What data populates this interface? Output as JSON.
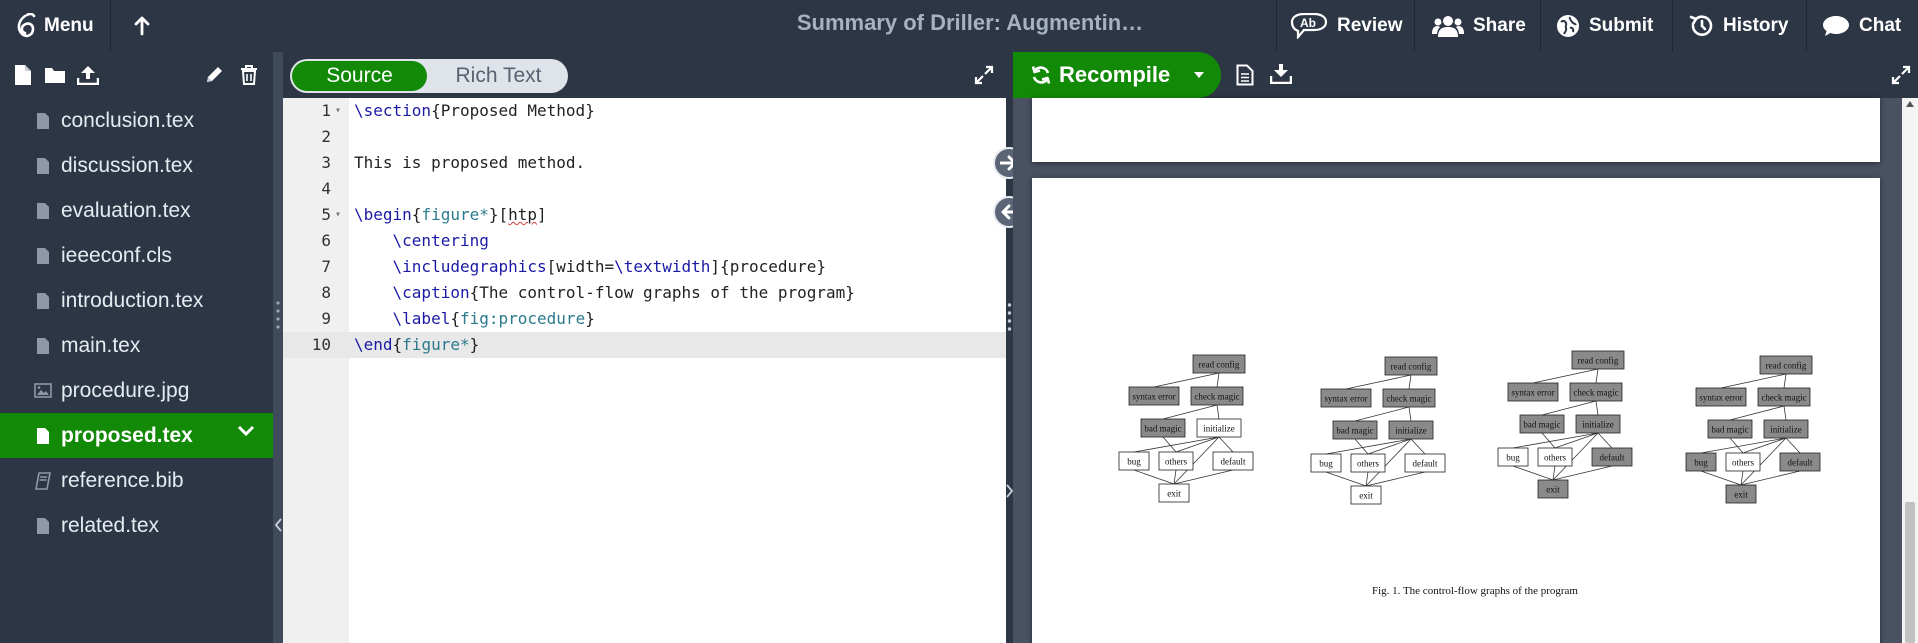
{
  "topbar": {
    "menu_label": "Menu",
    "project_title": "Summary of Driller: Augmentin…",
    "buttons": [
      {
        "label": "Review",
        "icon": "review-icon"
      },
      {
        "label": "Share",
        "icon": "users-icon"
      },
      {
        "label": "Submit",
        "icon": "globe-icon"
      },
      {
        "label": "History",
        "icon": "history-icon"
      },
      {
        "label": "Chat",
        "icon": "chat-bubble-icon"
      }
    ]
  },
  "file_tree": {
    "toolbar_icons": [
      "new-file-icon",
      "new-folder-icon",
      "upload-icon",
      "rename-pencil-icon",
      "delete-trash-icon"
    ],
    "files": [
      {
        "name": "conclusion.tex",
        "type": "file"
      },
      {
        "name": "discussion.tex",
        "type": "file"
      },
      {
        "name": "evaluation.tex",
        "type": "file"
      },
      {
        "name": "ieeeconf.cls",
        "type": "file"
      },
      {
        "name": "introduction.tex",
        "type": "file"
      },
      {
        "name": "main.tex",
        "type": "file"
      },
      {
        "name": "procedure.jpg",
        "type": "image"
      },
      {
        "name": "proposed.tex",
        "type": "file",
        "active": true
      },
      {
        "name": "reference.bib",
        "type": "bib"
      },
      {
        "name": "related.tex",
        "type": "file"
      }
    ]
  },
  "editor": {
    "mode_source": "Source",
    "mode_rich": "Rich Text",
    "active_mode": "Source",
    "current_line": 10,
    "lines": [
      {
        "n": "1",
        "fold": true,
        "segs": [
          [
            "kw",
            "\\section"
          ],
          [
            "",
            "{Proposed Method}"
          ]
        ]
      },
      {
        "n": "2",
        "segs": []
      },
      {
        "n": "3",
        "segs": [
          [
            "",
            "This is proposed method."
          ]
        ]
      },
      {
        "n": "4",
        "segs": []
      },
      {
        "n": "5",
        "fold": true,
        "segs": [
          [
            "kw",
            "\\begin"
          ],
          [
            "",
            "{"
          ],
          [
            "arg",
            "figure*"
          ],
          [
            "",
            "}["
          ],
          [
            "squig",
            "htp"
          ],
          [
            "",
            "]"
          ]
        ]
      },
      {
        "n": "6",
        "segs": [
          [
            "",
            "    "
          ],
          [
            "kw",
            "\\centering"
          ]
        ]
      },
      {
        "n": "7",
        "segs": [
          [
            "",
            "    "
          ],
          [
            "kw",
            "\\includegraphics"
          ],
          [
            "",
            "[width="
          ],
          [
            "kw",
            "\\textwidth"
          ],
          [
            "",
            "]{procedure}"
          ]
        ]
      },
      {
        "n": "8",
        "segs": [
          [
            "",
            "    "
          ],
          [
            "kw",
            "\\caption"
          ],
          [
            "",
            "{The control-flow graphs of the program}"
          ]
        ]
      },
      {
        "n": "9",
        "segs": [
          [
            "",
            "    "
          ],
          [
            "kw",
            "\\label"
          ],
          [
            "",
            "{"
          ],
          [
            "arg",
            "fig:procedure"
          ],
          [
            "",
            "}"
          ]
        ]
      },
      {
        "n": "10",
        "segs": [
          [
            "kw",
            "\\end"
          ],
          [
            "",
            "{"
          ],
          [
            "arg",
            "figure*"
          ],
          [
            "",
            "}"
          ]
        ]
      }
    ]
  },
  "pdf": {
    "recompile_label": "Recompile",
    "figure_caption": "Fig. 1.   The control-flow graphs of the program",
    "graph_labels": {
      "read_config": "read config",
      "syntax_error": "syntax error",
      "check_magic": "check magic",
      "bad_magic": "bad magic",
      "initialize": "initialize",
      "bug": "bug",
      "others": "others",
      "default": "default",
      "exit": "exit"
    },
    "graphs": [
      {
        "filled": [
          "read_config",
          "syntax_error",
          "check_magic",
          "bad_magic"
        ]
      },
      {
        "filled": [
          "read_config",
          "syntax_error",
          "check_magic",
          "bad_magic",
          "initialize"
        ]
      },
      {
        "filled": [
          "read_config",
          "syntax_error",
          "check_magic",
          "bad_magic",
          "initialize",
          "default",
          "exit"
        ]
      },
      {
        "filled": [
          "read_config",
          "syntax_error",
          "check_magic",
          "bad_magic",
          "initialize",
          "bug",
          "default",
          "exit"
        ]
      }
    ]
  },
  "colors": {
    "topbar_bg": "#2c3645",
    "accent_green": "#138a07",
    "keyword_blue": "#1a1aa6",
    "argument_teal": "#2a7a8c",
    "pdf_bg": "#4a5262"
  }
}
